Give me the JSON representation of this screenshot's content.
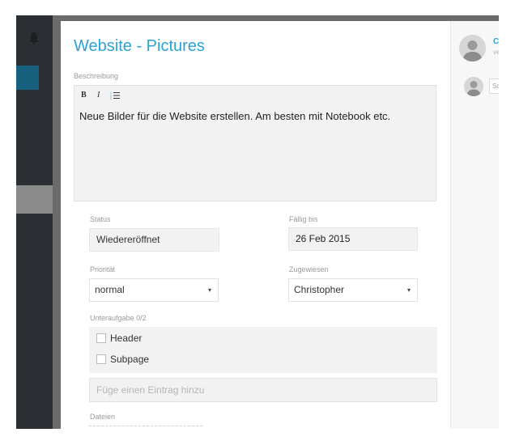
{
  "modal": {
    "title": "Website - Pictures",
    "description_label": "Beschreibung",
    "toolbar": {
      "bold": "B",
      "italic": "I"
    },
    "description_text": "Neue Bilder für die Website erstellen. Am besten mit Notebook etc.",
    "status_label": "Status",
    "status_value": "Wiedereröffnet",
    "due_label": "Fällig bis",
    "due_value": "26 Feb 2015",
    "priority_label": "Priorität",
    "priority_value": "normal",
    "assigned_label": "Zugewiesen",
    "assigned_value": "Christopher",
    "subtasks_label": "Unteraufgabe",
    "subtasks_count": "0/2",
    "subtasks": [
      {
        "label": "Header",
        "checked": false
      },
      {
        "label": "Subpage",
        "checked": false
      }
    ],
    "add_entry_placeholder": "Füge einen Eintrag hinzu",
    "files_label": "Dateien"
  },
  "right_panel": {
    "author_initial": "C",
    "author_sub": "ve",
    "comment_placeholder": "Sc"
  }
}
